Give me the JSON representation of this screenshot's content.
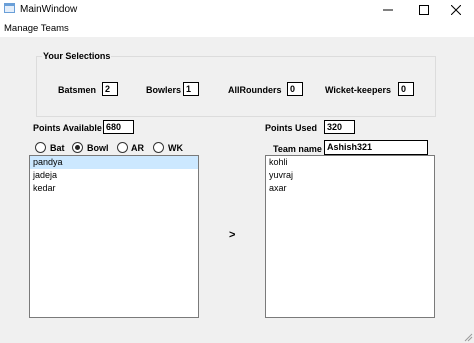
{
  "window": {
    "title": "MainWindow",
    "minimize_icon": "minimize-icon",
    "maximize_icon": "maximize-icon",
    "close_icon": "close-icon"
  },
  "menu": {
    "items": [
      "Manage Teams"
    ]
  },
  "selections": {
    "title": "Your Selections",
    "batsmen_label": "Batsmen",
    "batsmen_value": "2",
    "bowlers_label": "Bowlers",
    "bowlers_value": "1",
    "allrounders_label": "AllRounders",
    "allrounders_value": "0",
    "wicketkeepers_label": "Wicket-keepers",
    "wicketkeepers_value": "0"
  },
  "points": {
    "available_label": "Points Available",
    "available_value": "680",
    "used_label": "Points Used",
    "used_value": "320"
  },
  "team": {
    "name_label": "Team name",
    "name_value": "Ashish321"
  },
  "filter": {
    "options": [
      {
        "label": "Bat",
        "checked": false
      },
      {
        "label": "Bowl",
        "checked": true
      },
      {
        "label": "AR",
        "checked": false
      },
      {
        "label": "WK",
        "checked": false
      }
    ]
  },
  "available_players": [
    {
      "name": "pandya",
      "selected": true
    },
    {
      "name": "jadeja",
      "selected": false
    },
    {
      "name": "kedar",
      "selected": false
    }
  ],
  "selected_players": [
    {
      "name": "kohli"
    },
    {
      "name": "yuvraj"
    },
    {
      "name": "axar"
    }
  ],
  "transfer": {
    "label": ">"
  }
}
